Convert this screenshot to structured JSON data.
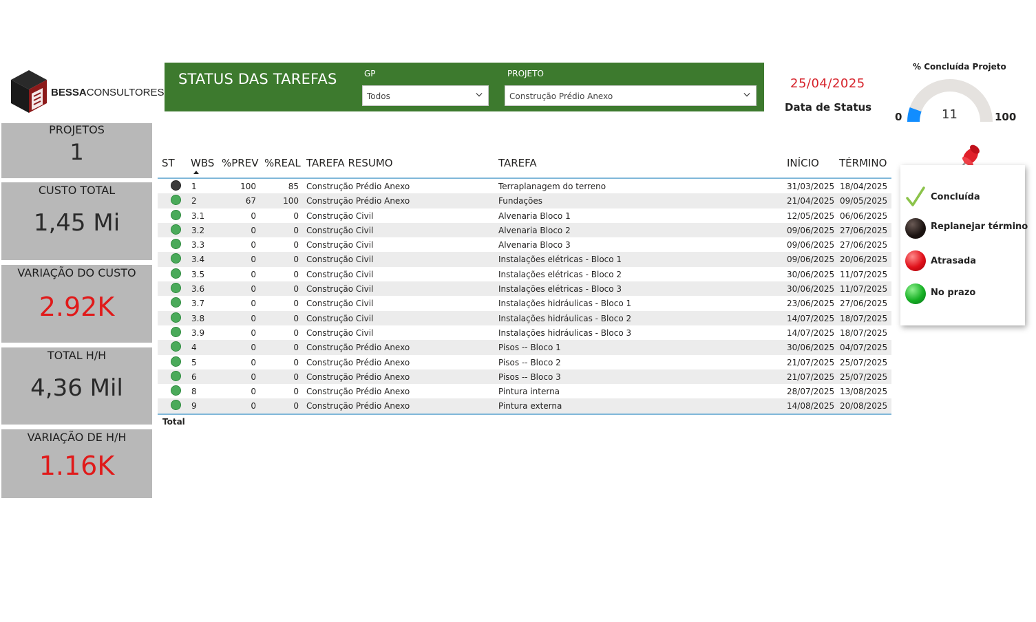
{
  "logo": {
    "brand_bold": "BESSA",
    "brand_light": "CONSULTORES"
  },
  "kpis": [
    {
      "label": "PROJETOS",
      "value": "1"
    },
    {
      "label": "CUSTO TOTAL",
      "value": "1,45 Mi"
    },
    {
      "label": "VARIAÇÃO DO CUSTO",
      "value": "2.92K"
    },
    {
      "label": "TOTAL H/H",
      "value": "4,36 Mil"
    },
    {
      "label": "VARIAÇÃO DE H/H",
      "value": "1.16K"
    }
  ],
  "header": {
    "title": "STATUS DAS TAREFAS",
    "gp_label": "GP",
    "gp_value": "Todos",
    "projeto_label": "PROJETO",
    "projeto_value": "Construção Prédio Anexo"
  },
  "status_date": {
    "value": "25/04/2025",
    "label": "Data de Status"
  },
  "gauge": {
    "title": "% Concluída Projeto",
    "min": "0",
    "max": "100",
    "value": "11",
    "fill_percent": 11
  },
  "colors": {
    "header_green": "#3d7a2e",
    "date_red": "#d6222a",
    "kpi_red": "#e01a1a",
    "gauge_blue": "#118dff",
    "status_green": "#4aaa5a",
    "status_black": "#3a3a3a"
  },
  "table": {
    "columns": [
      "ST",
      "WBS",
      "%PREV",
      "%REAL",
      "TAREFA RESUMO",
      "TAREFA",
      "INÍCIO",
      "TÉRMINO"
    ],
    "rows": [
      {
        "st": "black",
        "wbs": "1",
        "prev": "100",
        "real": "85",
        "resumo": "Construção Prédio Anexo",
        "tarefa": "Terraplanagem do terreno",
        "inicio": "31/03/2025",
        "termino": "18/04/2025"
      },
      {
        "st": "green",
        "wbs": "2",
        "prev": "67",
        "real": "100",
        "resumo": "Construção Prédio Anexo",
        "tarefa": "Fundações",
        "inicio": "21/04/2025",
        "termino": "09/05/2025"
      },
      {
        "st": "green",
        "wbs": "3.1",
        "prev": "0",
        "real": "0",
        "resumo": "Construção Civil",
        "tarefa": "Alvenaria Bloco 1",
        "inicio": "12/05/2025",
        "termino": "06/06/2025"
      },
      {
        "st": "green",
        "wbs": "3.2",
        "prev": "0",
        "real": "0",
        "resumo": "Construção Civil",
        "tarefa": "Alvenaria Bloco 2",
        "inicio": "09/06/2025",
        "termino": "27/06/2025"
      },
      {
        "st": "green",
        "wbs": "3.3",
        "prev": "0",
        "real": "0",
        "resumo": "Construção Civil",
        "tarefa": "Alvenaria Bloco 3",
        "inicio": "09/06/2025",
        "termino": "27/06/2025"
      },
      {
        "st": "green",
        "wbs": "3.4",
        "prev": "0",
        "real": "0",
        "resumo": "Construção Civil",
        "tarefa": "Instalações elétricas - Bloco 1",
        "inicio": "09/06/2025",
        "termino": "20/06/2025"
      },
      {
        "st": "green",
        "wbs": "3.5",
        "prev": "0",
        "real": "0",
        "resumo": "Construção Civil",
        "tarefa": "Instalações elétricas - Bloco 2",
        "inicio": "30/06/2025",
        "termino": "11/07/2025"
      },
      {
        "st": "green",
        "wbs": "3.6",
        "prev": "0",
        "real": "0",
        "resumo": "Construção Civil",
        "tarefa": "Instalações elétricas - Bloco 3",
        "inicio": "30/06/2025",
        "termino": "11/07/2025"
      },
      {
        "st": "green",
        "wbs": "3.7",
        "prev": "0",
        "real": "0",
        "resumo": "Construção Civil",
        "tarefa": "Instalações hidráulicas - Bloco 1",
        "inicio": "23/06/2025",
        "termino": "27/06/2025"
      },
      {
        "st": "green",
        "wbs": "3.8",
        "prev": "0",
        "real": "0",
        "resumo": "Construção Civil",
        "tarefa": "Instalações hidráulicas - Bloco 2",
        "inicio": "14/07/2025",
        "termino": "18/07/2025"
      },
      {
        "st": "green",
        "wbs": "3.9",
        "prev": "0",
        "real": "0",
        "resumo": "Construção Civil",
        "tarefa": "Instalações hidráulicas - Bloco 3",
        "inicio": "14/07/2025",
        "termino": "18/07/2025"
      },
      {
        "st": "green",
        "wbs": "4",
        "prev": "0",
        "real": "0",
        "resumo": "Construção Prédio Anexo",
        "tarefa": "Pisos -- Bloco 1",
        "inicio": "30/06/2025",
        "termino": "04/07/2025"
      },
      {
        "st": "green",
        "wbs": "5",
        "prev": "0",
        "real": "0",
        "resumo": "Construção Prédio Anexo",
        "tarefa": "Pisos -- Bloco 2",
        "inicio": "21/07/2025",
        "termino": "25/07/2025"
      },
      {
        "st": "green",
        "wbs": "6",
        "prev": "0",
        "real": "0",
        "resumo": "Construção Prédio Anexo",
        "tarefa": "Pisos -- Bloco 3",
        "inicio": "21/07/2025",
        "termino": "25/07/2025"
      },
      {
        "st": "green",
        "wbs": "8",
        "prev": "0",
        "real": "0",
        "resumo": "Construção Prédio Anexo",
        "tarefa": "Pintura interna",
        "inicio": "28/07/2025",
        "termino": "13/08/2025"
      },
      {
        "st": "green",
        "wbs": "9",
        "prev": "0",
        "real": "0",
        "resumo": "Construção Prédio Anexo",
        "tarefa": "Pintura externa",
        "inicio": "14/08/2025",
        "termino": "20/08/2025"
      }
    ],
    "total_label": "Total"
  },
  "legend": {
    "items": [
      {
        "icon": "check-icon",
        "label": "Concluída"
      },
      {
        "icon": "black-ball-icon",
        "label": "Replanejar término"
      },
      {
        "icon": "red-ball-icon",
        "label": "Atrasada"
      },
      {
        "icon": "green-ball-icon",
        "label": "No prazo"
      }
    ]
  }
}
